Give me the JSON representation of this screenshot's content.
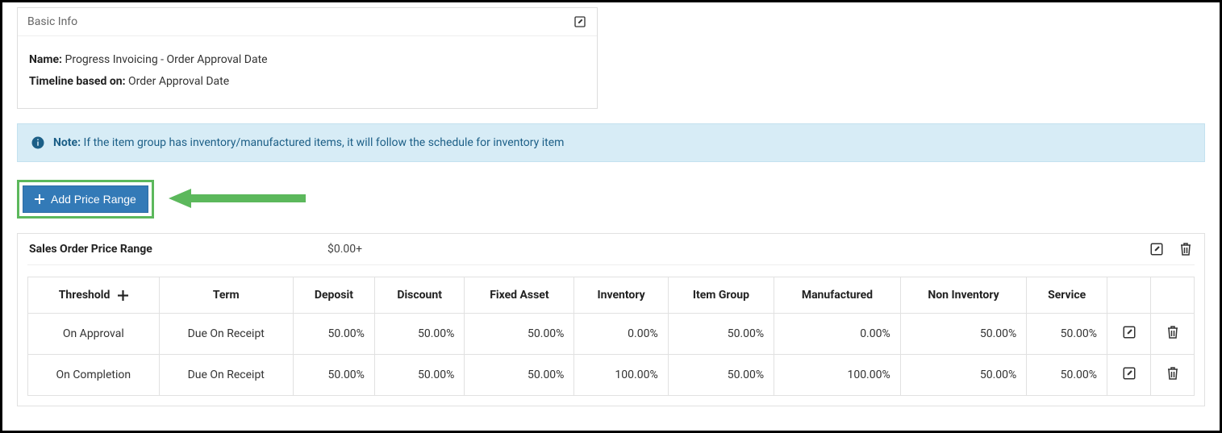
{
  "basic_info": {
    "panel_title": "Basic Info",
    "name_label": "Name:",
    "name_value": "Progress Invoicing - Order Approval Date",
    "timeline_label": "Timeline based on:",
    "timeline_value": "Order Approval Date"
  },
  "note": {
    "label": "Note:",
    "text": "If the item group has inventory/manufactured items, it will follow the schedule for inventory item"
  },
  "buttons": {
    "add_price_range": "Add Price Range"
  },
  "price_range": {
    "title": "Sales Order Price Range",
    "price": "$0.00+"
  },
  "table": {
    "headers": {
      "threshold": "Threshold",
      "term": "Term",
      "deposit": "Deposit",
      "discount": "Discount",
      "fixed_asset": "Fixed Asset",
      "inventory": "Inventory",
      "item_group": "Item Group",
      "manufactured": "Manufactured",
      "non_inventory": "Non Inventory",
      "service": "Service"
    },
    "rows": [
      {
        "threshold": "On Approval",
        "term": "Due On Receipt",
        "deposit": "50.00%",
        "discount": "50.00%",
        "fixed_asset": "50.00%",
        "inventory": "0.00%",
        "item_group": "50.00%",
        "manufactured": "0.00%",
        "non_inventory": "50.00%",
        "service": "50.00%"
      },
      {
        "threshold": "On Completion",
        "term": "Due On Receipt",
        "deposit": "50.00%",
        "discount": "50.00%",
        "fixed_asset": "50.00%",
        "inventory": "100.00%",
        "item_group": "50.00%",
        "manufactured": "100.00%",
        "non_inventory": "50.00%",
        "service": "50.00%"
      }
    ]
  },
  "colors": {
    "primary_button": "#337ab7",
    "highlight_border": "#5cb85c",
    "note_bg": "#d7ecf6",
    "note_text": "#1c5f87"
  }
}
